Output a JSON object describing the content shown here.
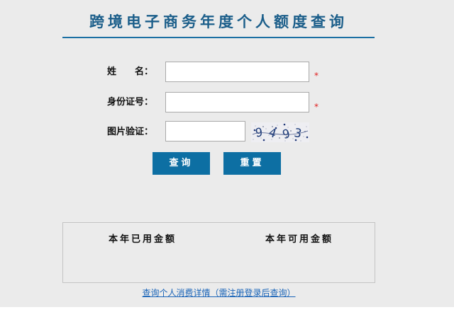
{
  "page": {
    "title": "跨境电子商务年度个人额度查询"
  },
  "form": {
    "name_label": "姓　　名：",
    "id_label": "身份证号：",
    "captcha_label": "图片验证：",
    "required_mark": "*",
    "name_value": "",
    "id_value": "",
    "captcha_value": "",
    "captcha_text": "9493"
  },
  "buttons": {
    "query": "查询",
    "reset": "重置"
  },
  "quota": {
    "used_header": "本年已用金额",
    "available_header": "本年可用金额"
  },
  "link": {
    "detail": "查询个人消费详情（需注册登录后查询）"
  },
  "colors": {
    "accent": "#0d6fa3",
    "title": "#1b5e8a",
    "required": "#e02020",
    "link": "#1a64b8",
    "background": "#ebebeb"
  }
}
